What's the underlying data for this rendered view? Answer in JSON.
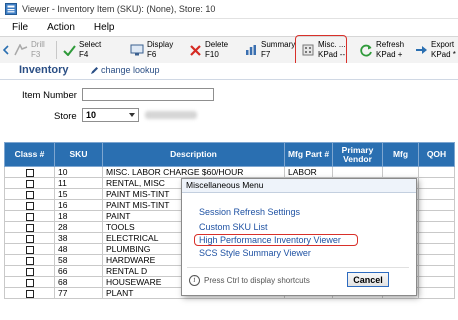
{
  "window": {
    "title": "Viewer - Inventory Item (SKU): (None), Store: 10"
  },
  "menu": {
    "items": [
      "File",
      "Action",
      "Help"
    ]
  },
  "toolbar": {
    "buttons": [
      {
        "label": "Drill",
        "shortcut": "F3",
        "icon": "drill-icon"
      },
      {
        "label": "Select",
        "shortcut": "F4",
        "icon": "checkmark-icon"
      },
      {
        "label": "Display",
        "shortcut": "F6",
        "icon": "display-icon"
      },
      {
        "label": "Delete",
        "shortcut": "F10",
        "icon": "delete-x-icon"
      },
      {
        "label": "Summary",
        "shortcut": "F7",
        "icon": "summary-icon"
      },
      {
        "label": "Misc. ...",
        "shortcut": "KPad --",
        "icon": "misc-icon"
      },
      {
        "label": "Refresh",
        "shortcut": "KPad +",
        "icon": "refresh-icon"
      },
      {
        "label": "Export",
        "shortcut": "KPad *",
        "icon": "export-icon"
      }
    ]
  },
  "section": {
    "title": "Inventory",
    "lookup_link": "change lookup"
  },
  "form": {
    "item_number_label": "Item Number",
    "item_number_value": "",
    "store_label": "Store",
    "store_value": "10"
  },
  "grid": {
    "headers": [
      "Class #",
      "SKU",
      "Description",
      "Mfg Part #",
      "Primary Vendor",
      "Mfg",
      "QOH"
    ],
    "rows": [
      [
        "",
        "10",
        "MISC. LABOR CHARGE $60/HOUR",
        "LABOR",
        "",
        "",
        ""
      ],
      [
        "",
        "11",
        "RENTAL, MISC",
        "",
        "",
        "",
        ""
      ],
      [
        "",
        "15",
        "PAINT MIS-TINT",
        "",
        "",
        "",
        ""
      ],
      [
        "",
        "16",
        "PAINT MIS-TINT",
        "",
        "",
        "",
        ""
      ],
      [
        "",
        "18",
        "PAINT",
        "",
        "",
        "",
        ""
      ],
      [
        "",
        "28",
        "TOOLS",
        "",
        "",
        "",
        ""
      ],
      [
        "",
        "38",
        "ELECTRICAL",
        "",
        "",
        "",
        ""
      ],
      [
        "",
        "48",
        "PLUMBING",
        "",
        "",
        "",
        ""
      ],
      [
        "",
        "58",
        "HARDWARE",
        "",
        "",
        "",
        ""
      ],
      [
        "",
        "66",
        "RENTAL D",
        "",
        "",
        "",
        ""
      ],
      [
        "",
        "68",
        "HOUSEWARE",
        "",
        "",
        "",
        ""
      ],
      [
        "",
        "77",
        "PLANT",
        "",
        "",
        "",
        ""
      ]
    ]
  },
  "dialog": {
    "title": "Miscellaneous Menu",
    "items": [
      "Session Refresh Settings",
      "Custom SKU List",
      "High Performance Inventory Viewer",
      "SCS Style Summary Viewer"
    ],
    "info_text": "Press Ctrl to display shortcuts",
    "cancel_label": "Cancel"
  },
  "colors": {
    "grid_header": "#2a6fb1",
    "link": "#1f52a3",
    "highlight": "#d8302a",
    "section_title": "#2b4f85"
  }
}
